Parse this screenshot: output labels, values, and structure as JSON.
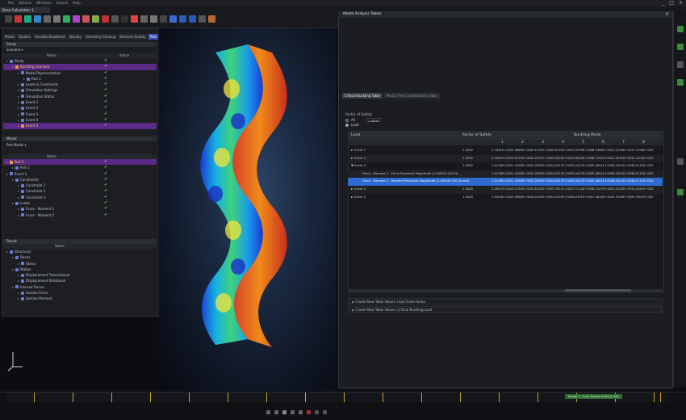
{
  "app": {
    "menu": [
      "File",
      "Options",
      "Windows",
      "Search",
      "Help"
    ],
    "session_tab": "Base Calculation 1",
    "window_controls": [
      "_",
      "□",
      "×"
    ]
  },
  "left_panel": {
    "tabs": [
      "Model",
      "Studies",
      "Variable Beadment",
      "Display",
      "Geometry Cleanup",
      "Element Quality",
      "Post"
    ],
    "active_tab": "Post",
    "study_section": {
      "title": "Study",
      "dropdown": "Scenario",
      "columns": [
        "Name",
        "Active"
      ],
      "rows": [
        {
          "label": "Study",
          "indent": 0,
          "highlight": false
        },
        {
          "label": "Buckling_Scenario",
          "indent": 1,
          "highlight": true
        },
        {
          "label": "Model Representation",
          "indent": 2,
          "highlight": false
        },
        {
          "label": "Part 1",
          "indent": 3,
          "highlight": false
        },
        {
          "label": "Loads & Constraints",
          "indent": 2,
          "highlight": false
        },
        {
          "label": "Simulation Settings",
          "indent": 2,
          "highlight": false
        },
        {
          "label": "Simulation Status",
          "indent": 2,
          "highlight": false
        },
        {
          "label": "Event 1",
          "indent": 2,
          "highlight": false
        },
        {
          "label": "Event 2",
          "indent": 2,
          "highlight": false
        },
        {
          "label": "Event 3",
          "indent": 2,
          "highlight": false
        },
        {
          "label": "Event 4",
          "indent": 2,
          "highlight": false
        },
        {
          "label": "Event 5",
          "indent": 2,
          "highlight": true
        }
      ]
    },
    "model_section": {
      "title": "Model",
      "dropdown": "Part Model",
      "columns": [
        "Name"
      ],
      "rows": [
        {
          "label": "Part 1",
          "indent": 0,
          "highlight": true
        },
        {
          "label": "Part 1",
          "indent": 1,
          "highlight": false
        },
        {
          "label": "Event 1",
          "indent": 0,
          "highlight": false
        },
        {
          "label": "Constraints",
          "indent": 1,
          "highlight": false
        },
        {
          "label": "Constraint 1",
          "indent": 2,
          "highlight": false
        },
        {
          "label": "Constraint 2",
          "indent": 2,
          "highlight": false
        },
        {
          "label": "Constraint 3",
          "indent": 2,
          "highlight": false
        },
        {
          "label": "Loads",
          "indent": 1,
          "highlight": false
        },
        {
          "label": "Force - Moment 1",
          "indent": 2,
          "highlight": false
        },
        {
          "label": "Force - Moment 2",
          "indent": 2,
          "highlight": false
        }
      ]
    },
    "result_section": {
      "title": "Result",
      "columns": [
        "Name"
      ],
      "rows": [
        {
          "label": "Structural",
          "indent": 0
        },
        {
          "label": "Stress",
          "indent": 1
        },
        {
          "label": "Stress",
          "indent": 2
        },
        {
          "label": "Motion",
          "indent": 1
        },
        {
          "label": "Displacement Translational",
          "indent": 2
        },
        {
          "label": "Displacement Rotational",
          "indent": 2
        },
        {
          "label": "Internal Forces",
          "indent": 1
        },
        {
          "label": "Section Force",
          "indent": 2
        },
        {
          "label": "Section Moment",
          "indent": 2
        }
      ]
    }
  },
  "dialog": {
    "title": "Modal Analysis Tables",
    "subtabs": [
      "Critical Buckling Table",
      "Modal Time Contributions Table"
    ],
    "active_subtab": "Critical Buckling Table",
    "factor_of_safety_label": "Factor of Safety",
    "radio_options": [
      "All",
      "Load"
    ],
    "radio_selected": "Load",
    "fos_value": "1.0000",
    "table": {
      "col_load": "Load",
      "col_fos": "Factor of Safety",
      "group_header": "Buckling Mode",
      "mode_numbers": [
        "1",
        "2",
        "3",
        "4",
        "5",
        "6",
        "7",
        "8"
      ],
      "rows": [
        {
          "load": "Event 1",
          "fos": "1.0000",
          "values": [
            "2.1892E+002",
            "3.4660E+002",
            "5.1031E+002",
            "5.6720E+002",
            "7.6378E+002",
            "8.5489E+002",
            "1.0720E+003",
            "1.1196E+003"
          ],
          "expander": "►",
          "child": false
        },
        {
          "load": "Event 2",
          "fos": "1.0000",
          "values": [
            "2.3081E+002",
            "3.6120E+002",
            "5.2971E+002",
            "5.9010E+002",
            "7.8010E+002",
            "8.7102E+002",
            "1.0931E+003",
            "1.1402E+003"
          ],
          "expander": "►",
          "child": false
        },
        {
          "load": "Event 3",
          "fos": "1.0000",
          "values": "1.0136E+002  1.1990E+002  2.2832E+002  4.0017E+002  5.4417E+002  5.4641E+002  6.4421E+002  6.5112E+002",
          "expander": "▼",
          "child": false
        },
        {
          "load": "Force - Moment 2 - Force Resultant Magnitude (1.0000E+002 N)",
          "fos": "",
          "values": [
            "1.0136E+002",
            "1.1990E+002",
            "2.2832E+002",
            "4.0017E+002",
            "5.4417E+002",
            "5.4641E+002",
            "6.4421E+002",
            "6.5112E+002"
          ],
          "expander": "",
          "child": true
        },
        {
          "load": "Force - Moment 2 - Moment Resultant Magnitude (1.0000E+002 N-mm)",
          "fos": "",
          "values": [
            "1.0136E+002",
            "1.1990E+002",
            "2.2832E+002",
            "4.0017E+002",
            "5.4417E+002",
            "5.4641E+002",
            "6.4421E+002",
            "6.5112E+002"
          ],
          "expander": "",
          "child": true,
          "selected": true
        },
        {
          "load": "Event 4",
          "fos": "1.0000",
          "values": [
            "2.0907E+002",
            "3.2781E+002",
            "4.8110E+002",
            "5.3921E+002",
            "7.2114E+002",
            "8.1207E+002",
            "1.0132E+003",
            "1.0591E+003"
          ],
          "expander": "►",
          "child": false
        },
        {
          "load": "Event 5",
          "fos": "1.0000",
          "values": [
            "1.9004E+002",
            "2.9980E+002",
            "4.4190E+002",
            "4.9410E+002",
            "6.6701E+002",
            "7.4810E+002",
            "9.3540E+002",
            "9.7801E+002"
          ],
          "expander": "►",
          "child": false
        }
      ]
    },
    "footer_rows": [
      "Create New Table Values: Load Scale Factor",
      "Create New Table Values: Critical Buckling Load"
    ]
  },
  "timeline": {
    "status": "Model 1: Scan Period 0000/1.000"
  },
  "colors": {
    "accent": "#3b4dc4",
    "highlight_row": "#5b2a86",
    "selected_row": "#2f6bd0"
  }
}
